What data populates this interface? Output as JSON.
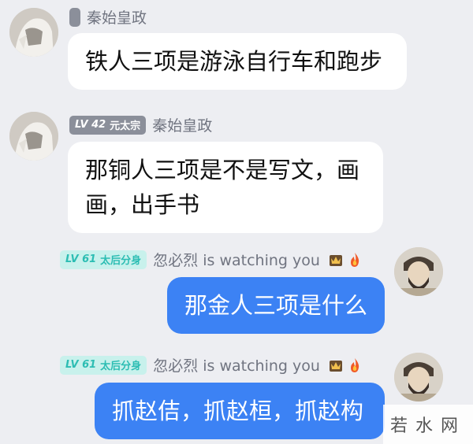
{
  "messages": [
    {
      "side": "left",
      "badge": "",
      "badge_level": "",
      "sender": "秦始皇政",
      "text_lines": [
        "铁人三项是游泳自行车和跑步"
      ],
      "avatar": "sculpture-avatar"
    },
    {
      "side": "left",
      "badge_level": "LV 42",
      "badge": "元太宗",
      "sender": "秦始皇政",
      "text_lines": [
        "那铜人三项是不是写文，画",
        "画，出手书"
      ],
      "avatar": "sculpture-avatar"
    },
    {
      "side": "right",
      "badge_level": "LV 61",
      "badge": "太后分身",
      "sender": "忽必烈 is watching you",
      "text_lines": [
        "那金人三项是什么"
      ],
      "avatar": "bearded-man-avatar",
      "icons": [
        "crown-badge-icon",
        "fire-icon"
      ]
    },
    {
      "side": "right",
      "badge_level": "LV 61",
      "badge": "太后分身",
      "sender": "忽必烈 is watching you",
      "text_lines": [
        "抓赵佶，抓赵桓，抓赵构"
      ],
      "avatar": "bearded-man-avatar",
      "icons": [
        "crown-badge-icon",
        "fire-icon"
      ]
    }
  ],
  "watermark": "若水网",
  "colors": {
    "background": "#edeef2",
    "left_bubble": "#ffffff",
    "right_bubble": "#3c82f4",
    "badge_teal_bg": "#c8f1ec",
    "badge_teal_text": "#2cbdb3",
    "badge_dark_bg": "#8b8f9a"
  }
}
